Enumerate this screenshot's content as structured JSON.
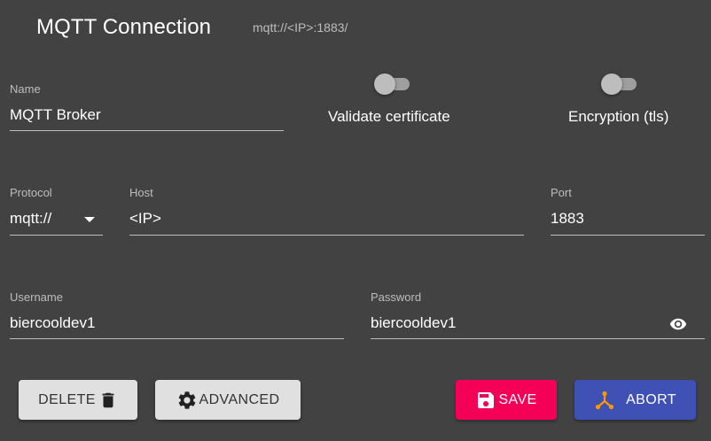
{
  "dialog": {
    "title": "MQTT Connection",
    "subtitle": "mqtt://<IP>:1883/"
  },
  "fields": {
    "name": {
      "label": "Name",
      "value": "MQTT Broker"
    },
    "protocol": {
      "label": "Protocol",
      "value": "mqtt://"
    },
    "host": {
      "label": "Host",
      "value": "<IP>"
    },
    "port": {
      "label": "Port",
      "value": "1883"
    },
    "username": {
      "label": "Username",
      "value": "biercooldev1"
    },
    "password": {
      "label": "Password",
      "value": "biercooldev1"
    }
  },
  "toggles": {
    "validate_certificate": {
      "label": "Validate certificate",
      "checked": false
    },
    "encryption": {
      "label": "Encryption (tls)",
      "checked": false
    }
  },
  "buttons": {
    "delete": {
      "label": "DELETE",
      "icon": "trash-icon"
    },
    "advanced": {
      "label": "ADVANCED",
      "icon": "gear-icon"
    },
    "save": {
      "label": "SAVE",
      "icon": "floppy-disk-icon"
    },
    "abort": {
      "label": "ABORT",
      "icon": "connection-nodes-icon"
    }
  },
  "colors": {
    "background": "#424242",
    "save": "#f50057",
    "abort": "#3f51b5",
    "light_button": "#e0e0e0",
    "abort_icon": "#ff9800"
  }
}
